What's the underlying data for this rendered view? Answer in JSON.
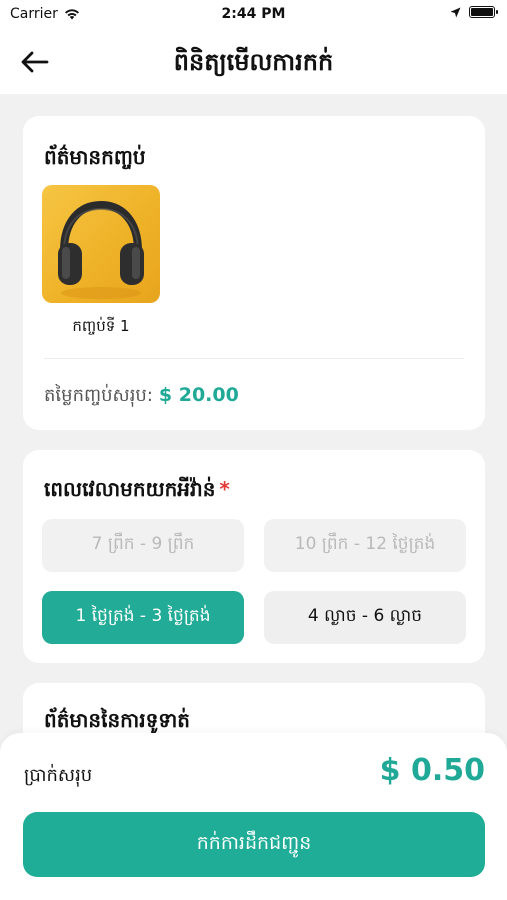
{
  "status_bar": {
    "carrier": "Carrier",
    "time": "2:44 PM"
  },
  "header": {
    "title": "ពិនិត្យមើលការកក់"
  },
  "package_info": {
    "title": "ព័ត៌មានកញ្ចប់",
    "items": [
      {
        "name": "កញ្ចប់ទី 1",
        "icon": "headphones-image"
      }
    ],
    "total_label": "តម្លៃកញ្ចប់សរុប:",
    "total_value": "$ 20.00"
  },
  "pickup_time": {
    "title": "ពេលវេលាមកយកអីវ៉ាន់",
    "required_mark": "*",
    "slots": [
      {
        "label": "7 ព្រឹក - 9 ព្រឹក",
        "state": "disabled"
      },
      {
        "label": "10 ព្រឹក - 12 ថ្ងៃត្រង់",
        "state": "disabled"
      },
      {
        "label": "1 ថ្ងៃត្រង់ - 3 ថ្ងៃត្រង់",
        "state": "selected"
      },
      {
        "label": "4 ល្ងាច - 6 ល្ងាច",
        "state": "normal"
      }
    ]
  },
  "payment_info": {
    "title": "ព័ត៌មាននៃការទូទាត់"
  },
  "footer": {
    "sum_label": "ប្រាក់សរុប",
    "sum_value": "$ 0.50",
    "cta_label": "កក់ការដឹកជញ្ជូន"
  },
  "colors": {
    "accent": "#20ad97",
    "required": "#e53935"
  }
}
